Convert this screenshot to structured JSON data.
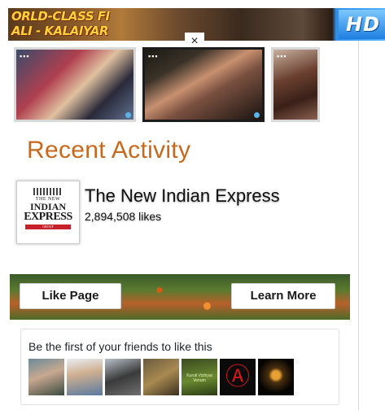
{
  "ad_banner": {
    "text": "ORLD-CLASS FI\nALI - KALAIYAR",
    "badge": "HD"
  },
  "close_glyph": "×",
  "thumbnails": [
    {
      "dots": "▪▪▪"
    },
    {
      "dots": "▪▪▪"
    },
    {
      "dots": "▪▪▪"
    }
  ],
  "section_title": "Recent Activity",
  "page": {
    "name": "The New Indian Express",
    "likes": "2,894,508 likes",
    "logo": {
      "line1": "THE NEW",
      "line2": "INDIAN",
      "line3": "EXPRESS",
      "line4": "GROUP"
    }
  },
  "buttons": {
    "like": "Like Page",
    "learn_more": "Learn More"
  },
  "friends": {
    "text": "Be the first of your friends to like this",
    "thumb5_caption": "Kuruti Vizhiyai Venum",
    "thumb6_glyph": "Ⓐ"
  },
  "colors": {
    "title": "#c8681c",
    "divider": "#d6d6d6"
  }
}
